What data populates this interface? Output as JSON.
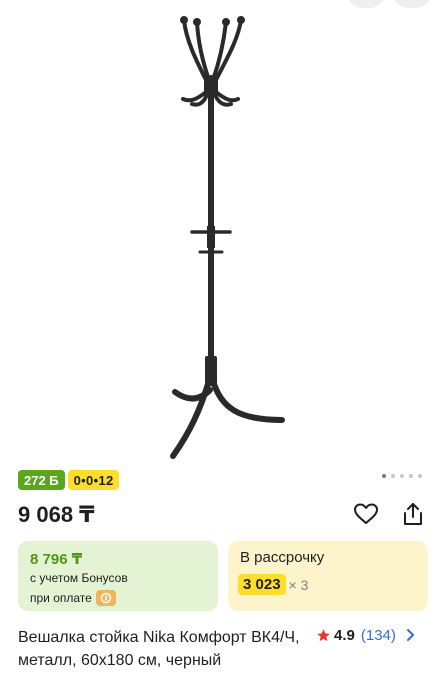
{
  "badges": {
    "points": "272 Б",
    "installment": "0•0•12"
  },
  "price": "9 068 ₸",
  "bonus_card": {
    "price": "8 796 ₸",
    "line1": "с учетом Бонусов",
    "line2": "при оплате"
  },
  "installment_card": {
    "title": "В рассрочку",
    "amount": "3 023",
    "multiplier": "× 3"
  },
  "product": {
    "title": "Вешалка стойка Nika Комфорт ВК4/Ч, металл, 60x180 см, черный"
  },
  "rating": {
    "value": "4.9",
    "count": "(134)"
  },
  "carousel": {
    "total": 5,
    "active": 0
  },
  "colors": {
    "accent_green": "#5aa61c",
    "accent_yellow": "#ffdd2d",
    "link_blue": "#2f6fd6",
    "star_red": "#e53935"
  },
  "icons": [
    "heart-icon",
    "share-icon",
    "star-icon",
    "chevron-right-icon",
    "kaspi-icon"
  ]
}
